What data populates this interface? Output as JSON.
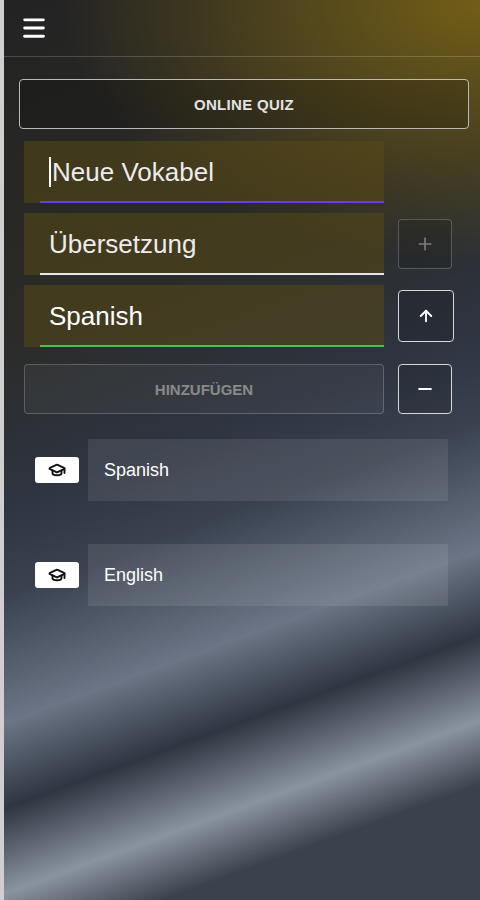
{
  "quiz_button": {
    "label": "ONLINE QUIZ"
  },
  "fields": [
    {
      "placeholder": "Neue Vokabel",
      "value": "",
      "focused": true,
      "color": "#6a3fe0"
    },
    {
      "placeholder": "Übersetzung",
      "value": "",
      "focused": false,
      "color": "#e6e6e6"
    },
    {
      "placeholder": "",
      "value": "Spanish",
      "focused": false,
      "color": "#3ec84a"
    }
  ],
  "side_buttons": [
    {
      "kind": "add",
      "disabled": true
    },
    {
      "kind": "up",
      "disabled": false
    },
    {
      "kind": "remove",
      "disabled": false
    }
  ],
  "add_button": {
    "label": "HINZUFÜGEN",
    "disabled": true
  },
  "lists": [
    {
      "name": "Spanish"
    },
    {
      "name": "English"
    }
  ]
}
